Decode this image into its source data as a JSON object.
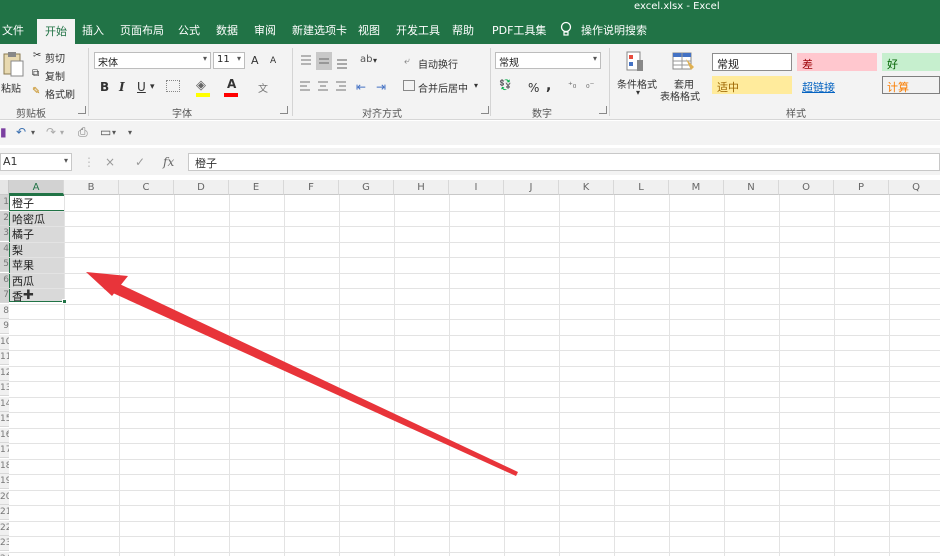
{
  "window": {
    "title": "excel.xlsx  -  Excel"
  },
  "tabs": [
    "文件",
    "开始",
    "插入",
    "页面布局",
    "公式",
    "数据",
    "审阅",
    "新建选项卡",
    "视图",
    "开发工具",
    "帮助",
    "PDF工具集"
  ],
  "active_tab": "开始",
  "tell_me": "操作说明搜索",
  "clipboard": {
    "paste": "粘贴",
    "cut": "剪切",
    "copy": "复制",
    "format_painter": "格式刷",
    "label": "剪贴板"
  },
  "font": {
    "name": "宋体",
    "size": "11",
    "grow": "A",
    "shrink": "A",
    "bold": "B",
    "italic": "I",
    "underline": "U",
    "font_color": "A",
    "phonetic": "文",
    "label": "字体"
  },
  "alignment": {
    "wrap_text": "自动换行",
    "merge_center": "合并后居中",
    "orientation": "ab",
    "label": "对齐方式"
  },
  "number": {
    "format": "常规",
    "percent": "%",
    "comma": ",",
    "label": "数字"
  },
  "styles": {
    "conditional": "条件格式",
    "format_as_table_1": "套用",
    "format_as_table_2": "表格格式",
    "label": "样式",
    "cells": [
      {
        "text": "常规",
        "bg": "#ffffff",
        "color": "#222222",
        "border": "#8c8c8c"
      },
      {
        "text": "差",
        "bg": "#ffc7ce",
        "color": "#9c0006",
        "border": "#ffc7ce"
      },
      {
        "text": "好",
        "bg": "#c6efce",
        "color": "#006100",
        "border": "#c6efce"
      },
      {
        "text": "适中",
        "bg": "#ffeb9c",
        "color": "#9c6500",
        "border": "#ffeb9c"
      },
      {
        "text": "超链接",
        "bg": "#f3f3f3",
        "color": "#0563c1",
        "border": "#f3f3f3"
      },
      {
        "text": "计算",
        "bg": "#f2f2f2",
        "color": "#fa7d00",
        "border": "#7f7f7f"
      }
    ]
  },
  "formula_bar": {
    "name_box": "A1",
    "cancel": "×",
    "enter": "✓",
    "fx": "fx",
    "content": "橙子"
  },
  "columns": [
    "A",
    "B",
    "C",
    "D",
    "E",
    "F",
    "G",
    "H",
    "I",
    "J",
    "K",
    "L",
    "M",
    "N",
    "O",
    "P",
    "Q"
  ],
  "rows": [
    "1",
    "2",
    "3",
    "4",
    "5",
    "6",
    "7",
    "8",
    "9",
    "10",
    "11",
    "12",
    "13",
    "14",
    "15",
    "16",
    "17",
    "18",
    "19",
    "20",
    "21",
    "22",
    "23",
    "24"
  ],
  "cells_a": [
    "橙子",
    "哈密瓜",
    "橘子",
    "梨",
    "苹果",
    "西瓜",
    "香"
  ],
  "colors": {
    "excel_green": "#217346",
    "arrow": "#e8343a"
  }
}
